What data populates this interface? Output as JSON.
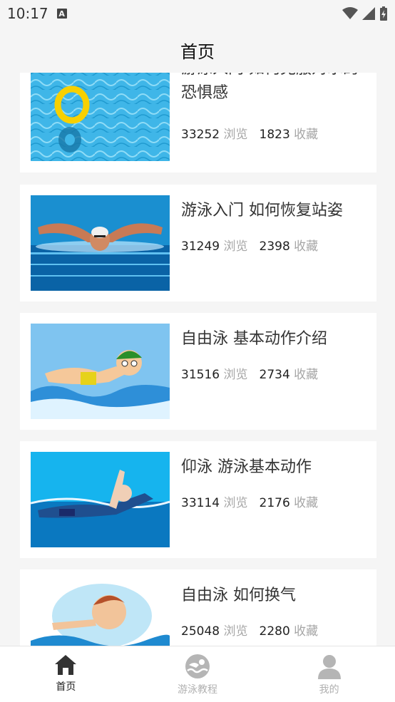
{
  "status_bar": {
    "time": "10:17",
    "a_badge": "A"
  },
  "header": {
    "title": "首页"
  },
  "articles": [
    {
      "title": "游泳入门 如何克服对水的恐惧感",
      "views": "33252",
      "views_label": "浏览",
      "favorites": "1823",
      "favorites_label": "收藏",
      "image": "swim-ring-in-pool"
    },
    {
      "title": "游泳入门 如何恢复站姿",
      "views": "31249",
      "views_label": "浏览",
      "favorites": "2398",
      "favorites_label": "收藏",
      "image": "butterfly-swimmer"
    },
    {
      "title": "自由泳 基本动作介绍",
      "views": "31516",
      "views_label": "浏览",
      "favorites": "2734",
      "favorites_label": "收藏",
      "image": "cartoon-swimmer-green-cap"
    },
    {
      "title": "仰泳 游泳基本动作",
      "views": "33114",
      "views_label": "浏览",
      "favorites": "2176",
      "favorites_label": "收藏",
      "image": "backstroke-swimmer"
    },
    {
      "title": "自由泳 如何换气",
      "views": "25048",
      "views_label": "浏览",
      "favorites": "2280",
      "favorites_label": "收藏",
      "image": "cartoon-swimmer-breathing"
    }
  ],
  "tab_bar": {
    "tabs": [
      {
        "label": "首页",
        "icon": "home-icon",
        "active": true
      },
      {
        "label": "游泳教程",
        "icon": "swim-icon",
        "active": false
      },
      {
        "label": "我的",
        "icon": "person-icon",
        "active": false
      }
    ]
  },
  "colors": {
    "background": "#f5f5f5",
    "card": "#ffffff",
    "muted": "#a6a6a6",
    "active_tab": "#222222",
    "inactive_tab": "#b0b0b0"
  }
}
